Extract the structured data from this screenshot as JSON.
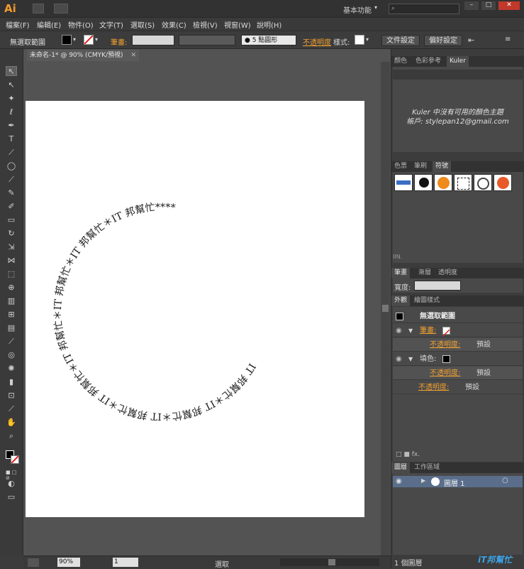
{
  "app": {
    "logo": "Ai",
    "workspace": "基本功能",
    "search_placeholder": ""
  },
  "menu": [
    "檔案(F)",
    "編輯(E)",
    "物件(O)",
    "文字(T)",
    "選取(S)",
    "效果(C)",
    "檢視(V)",
    "視窗(W)",
    "說明(H)"
  ],
  "control": {
    "selection": "無選取範圍",
    "stroke_label": "筆畫:",
    "brush": "5 點圓形",
    "opacity_label": "不透明度",
    "style_label": "樣式:",
    "doc_setup": "文件設定",
    "prefs": "偏好設定"
  },
  "document": {
    "tab": "未命名-1* @ 90% (CMYK/預視)",
    "zoom": "90%",
    "page": "1",
    "status": "選取"
  },
  "circle_text": "IT 邦幫忙＊IT 邦幫忙＊IT 邦幫忙＊IT 邦幫忙＊IT 邦幫忙＊IT 邦幫忙＊IT 邦幫忙＊IT 邦幫忙****",
  "panels": {
    "color_tabs": [
      "顏色",
      "色彩參考",
      "Kuler"
    ],
    "kuler_msg": "Kuler 中沒有可用的顏色主題",
    "kuler_account": "帳戶: stylepan12@gmail.com",
    "swatch_tabs": [
      "色票",
      "筆刷",
      "符號"
    ],
    "stroke_tabs": [
      "筆畫",
      "漸層",
      "透明度"
    ],
    "weight_label": "寬度:",
    "appearance_tabs": [
      "外觀",
      "繪圖樣式"
    ],
    "appearance": {
      "title": "無選取範圍",
      "stroke": "筆畫:",
      "opacity1": "不透明度:",
      "opacity1_val": "預設",
      "fill": "填色:",
      "opacity2": "不透明度:",
      "opacity2_val": "預設",
      "opacity3": "不透明度:",
      "opacity3_val": "預設"
    },
    "layers_tabs": [
      "圖層",
      "工作區域"
    ],
    "layer_name": "圖層 1",
    "layers_count": "1 個圖層"
  },
  "watermark": "iT邦幫忙"
}
